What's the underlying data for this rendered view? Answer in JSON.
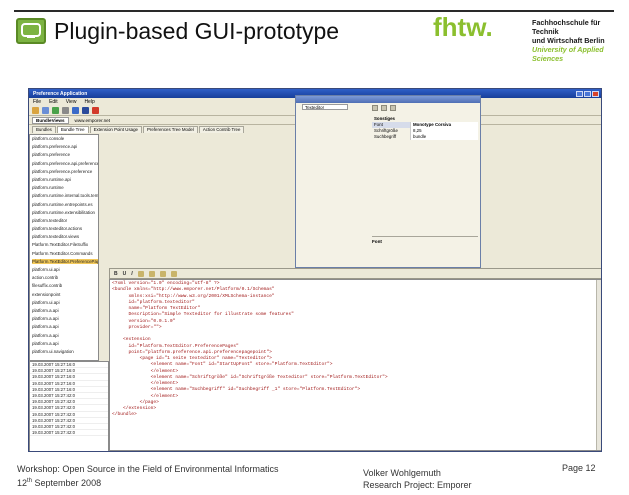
{
  "slide": {
    "title": "Plugin-based GUI-prototype",
    "logo_text": "fhtw.",
    "institution": {
      "line1": "Fachhochschule für Technik",
      "line2": "und Wirtschaft Berlin",
      "line3": "University of Applied Sciences"
    },
    "footer": {
      "event": "Workshop:  Open Source in the Field of Environmental Informatics",
      "date_day": "12",
      "date_suffix": "th",
      "date_rest": " September 2008",
      "author": "Volker Wohlgemuth",
      "project": "Research Project: Emporer",
      "page": "Page 12"
    },
    "colors": {
      "brand_green": "#8bbf2e",
      "title_bar_blue": "#2f5fc8",
      "code_red": "#a01818"
    }
  },
  "app": {
    "window_title": "Preference Application",
    "menus": [
      "File",
      "Edit",
      "View",
      "Help"
    ],
    "view_selector": [
      "BundleViews",
      "www.emporer.net"
    ],
    "tabs": [
      "Bundles",
      "Bundle Tree",
      "Extension Point Usage",
      "Preferences Tree Model",
      "Action Contrib Tree"
    ],
    "tree": [
      "platform.console",
      "platform.preference.api",
      "platform.preference",
      "platform.preference.api.preferencepagepoint",
      "platform.preference.preference",
      "platform.runtime.api",
      "platform.runtime",
      "platform.runtime.internal.tools.tempmodify",
      "platform.runtime.entrepoints.es",
      "platform.runtime.extensibilitation",
      "platform.texteditor",
      "platform.texteditor.actions",
      "platform.texteditor.views",
      "Platform.TextEditor.FileSuffix",
      "Platform.TextEditor.Commands",
      "Platform.TextEditor.PreferencePages",
      "platform.ui.api",
      "action.contrib",
      "filesuffix.contrib",
      "extensionpoint",
      "platform.ui.api",
      "platform.a.api",
      "platform.a.api",
      "platform.a.api",
      "platform.a.api",
      "platform.a.api",
      "platform.ui.navigation"
    ],
    "properties": {
      "tab": "Texteditor",
      "category": "Sonstiges",
      "rows": [
        {
          "key": "Font",
          "value": "Monotype Corsiva"
        },
        {
          "key": "Schriftgröße",
          "value": "8,25"
        },
        {
          "key": "Suchbegriff",
          "value": "bundle"
        }
      ],
      "footer_label": "Font"
    },
    "editor_buttons": [
      "B",
      "U",
      "I"
    ],
    "editor_code": "<?xml version=\"1.0\" encoding=\"utf-8\" ?>\n<bundle xmlns=\"http://www.emporer.net/Platform/0.1/Schemas\"\n      xmlns:xsi=\"http://www.w3.org/2001/XMLSchema-instance\"\n      id=\"platform.texteditor\"\n      name=\"Platform TextEditor\"\n      Description=\"Simple Texteditor for illustrate some features\"\n      version=\"0.0.1.0\"\n      provider=\"\">\n\n    <extension\n      id=\"Platform.TextEditor.PreferencePages\"\n      point=\"platform.preference.api.preferencepagepoint\">\n          <page id=\"1 seite texteditor\" name=\"Texteditor\">\n              <element name=\"Font\" id=\"StartUpFont\" store=\"Platform.TextEditor\">\n              </element>\n              <element name=\"Schriftgröße\" id=\"Schriftgröße Texteditor\" store=\"Platform.TextEditor\">\n              </element>\n              <element name=\"Suchbegriff\" id=\"Suchbegriff _1\" store=\"Platform.TextEditor\">\n              </element>\n          </page>\n    </extension>\n</bundle>",
    "log_entries": [
      "19.03.2007 15:27:16:0",
      "19.03.2007 15:27:16:0",
      "19.03.2007 15:27:16:0",
      "19.03.2007 15:27:16:0",
      "19.03.2007 15:27:16:0",
      "19.03.2007 15:27:42:0",
      "19.03.2007 15:27:42:0",
      "19.03.2007 15:27:42:0",
      "19.03.2007 15:27:42:0",
      "19.03.2007 15:27:42:0",
      "19.03.2007 15:27:42:0",
      "19.03.2007 15:27:42:0"
    ]
  }
}
